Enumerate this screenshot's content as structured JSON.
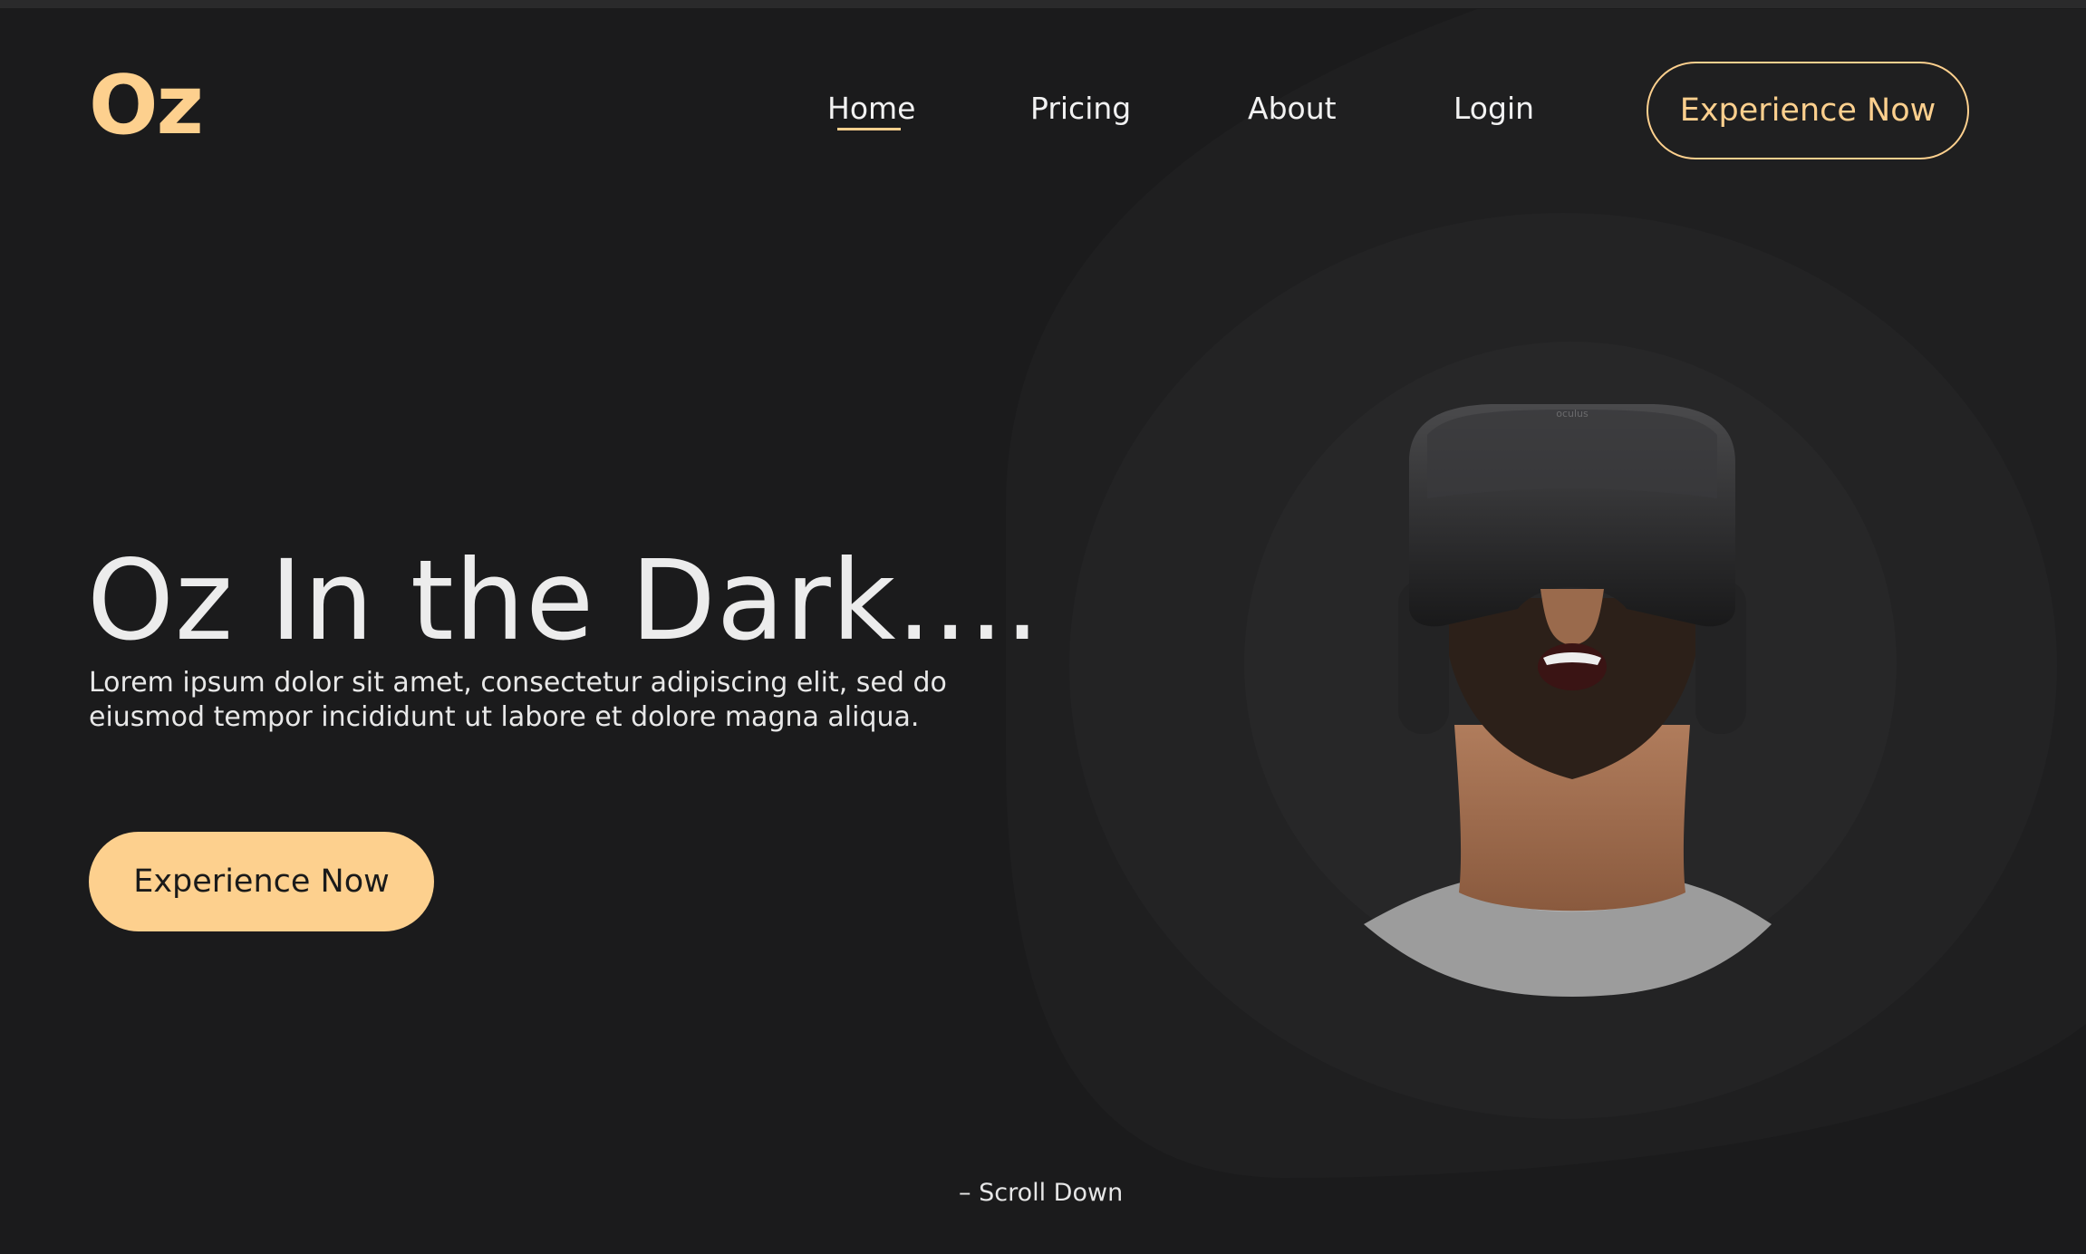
{
  "brand": {
    "logo": "Oz",
    "accent": "#fdd08e"
  },
  "nav": {
    "items": [
      {
        "label": "Home",
        "active": true
      },
      {
        "label": "Pricing"
      },
      {
        "label": "About"
      },
      {
        "label": "Login"
      }
    ],
    "cta": "Experience Now"
  },
  "hero": {
    "title": "Oz In the Dark....",
    "text": "Lorem ipsum dolor sit amet, consectetur adipiscing elit, sed do eiusmod tempor incididunt ut labore et dolore magna aliqua.",
    "cta": "Experience Now",
    "image": "person-wearing-vr-headset",
    "headset_brand": "oculus"
  },
  "footer": {
    "scroll_label": "– Scroll Down"
  },
  "colors": {
    "background": "#1b1b1c",
    "blob_outer": "#1f1f20",
    "blob_mid": "#232324",
    "blob_inner": "#272728"
  }
}
